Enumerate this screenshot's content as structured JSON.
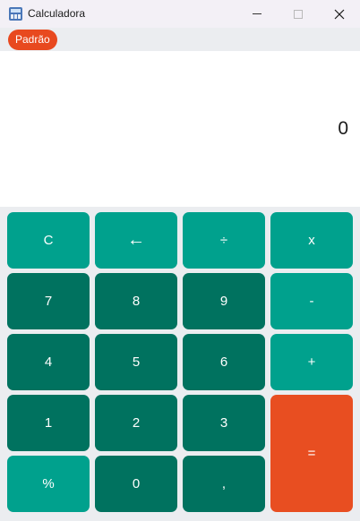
{
  "window": {
    "title": "Calculadora"
  },
  "toolbar": {
    "mode_label": "Padrão"
  },
  "display": {
    "value": "0"
  },
  "keys": {
    "clear": "C",
    "backspace": "←",
    "divide": "÷",
    "multiply": "x",
    "seven": "7",
    "eight": "8",
    "nine": "9",
    "subtract": "-",
    "four": "4",
    "five": "5",
    "six": "6",
    "add": "+",
    "one": "1",
    "two": "2",
    "three": "3",
    "equals": "=",
    "percent": "%",
    "zero": "0",
    "decimal": ","
  },
  "colors": {
    "key_light": "#00a18d",
    "key_dark": "#00725f",
    "accent": "#e84e21",
    "display_bg": "#ffffff",
    "keypad_bg": "#ebedf0"
  }
}
